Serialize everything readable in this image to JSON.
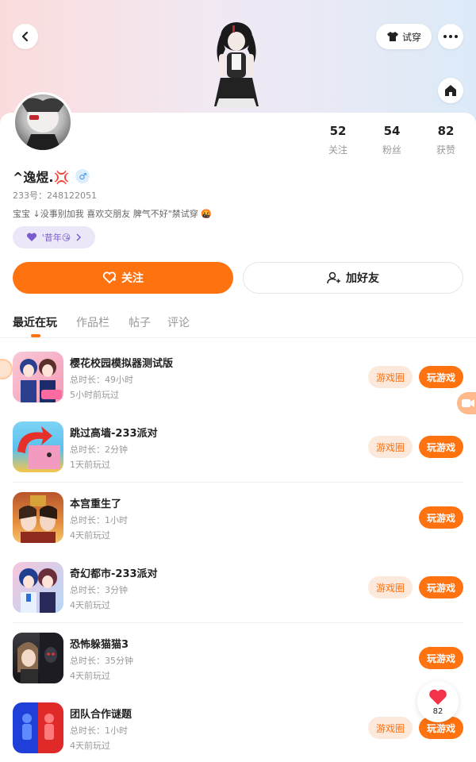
{
  "header": {
    "try_on_label": "试穿"
  },
  "profile": {
    "nickname": "^逸煜.💢",
    "gender_symbol": "♂",
    "uid": "233号：248122051",
    "bio": "宝宝 ↓没事别加我 喜欢交朋友 脾气不好\"禁试穿 🤬",
    "tag": "'昔年😘"
  },
  "stats": [
    {
      "num": "52",
      "label": "关注"
    },
    {
      "num": "54",
      "label": "粉丝"
    },
    {
      "num": "82",
      "label": "获赞"
    }
  ],
  "actions": {
    "follow_label": "关注",
    "add_friend_label": "加好友"
  },
  "tabs": [
    "最近在玩",
    "作品栏",
    "帖子",
    "评论"
  ],
  "games": [
    {
      "title": "樱花校园模拟器测试版",
      "duration": "总时长：49小时",
      "last_played": "5小时前玩过",
      "circle": "游戏圈",
      "play": "玩游戏"
    },
    {
      "title": "跳过高墙-233派对",
      "duration": "总时长：2分钟",
      "last_played": "1天前玩过",
      "circle": "游戏圈",
      "play": "玩游戏"
    },
    {
      "title": "本宫重生了",
      "duration": "总时长：1小时",
      "last_played": "4天前玩过",
      "circle": "",
      "play": "玩游戏"
    },
    {
      "title": "奇幻都市-233派对",
      "duration": "总时长：3分钟",
      "last_played": "4天前玩过",
      "circle": "游戏圈",
      "play": "玩游戏"
    },
    {
      "title": "恐怖躲猫猫3",
      "duration": "总时长：35分钟",
      "last_played": "4天前玩过",
      "circle": "",
      "play": "玩游戏"
    },
    {
      "title": "团队合作谜题",
      "duration": "总时长：1小时",
      "last_played": "4天前玩过",
      "circle": "游戏圈",
      "play": "玩游戏"
    }
  ],
  "like_fab": {
    "count": "82"
  },
  "colors": {
    "accent": "#ff7210",
    "circle_bg": "#fde8dc",
    "tag_bg": "#ece6f9"
  }
}
